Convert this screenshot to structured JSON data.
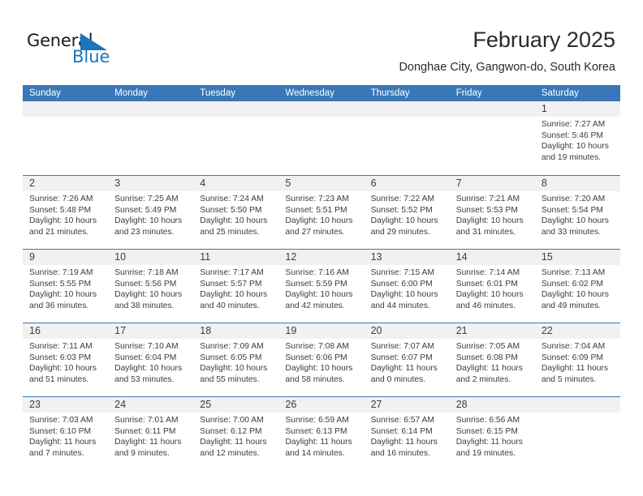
{
  "brand": {
    "name_part1": "General",
    "name_part2": "Blue",
    "triangle_color": "#1b75bc"
  },
  "header": {
    "month_title": "February 2025",
    "location": "Donghae City, Gangwon-do, South Korea"
  },
  "theme": {
    "header_blue": "#3878b8",
    "day_band_gray": "#f1f1f1",
    "text_dark": "#3c3c3c",
    "brand_blue": "#1b75bc"
  },
  "weekdays": [
    "Sunday",
    "Monday",
    "Tuesday",
    "Wednesday",
    "Thursday",
    "Friday",
    "Saturday"
  ],
  "weeks": [
    [
      {
        "day": "",
        "sunrise": "",
        "sunset": "",
        "daylight": "",
        "empty": true
      },
      {
        "day": "",
        "sunrise": "",
        "sunset": "",
        "daylight": "",
        "empty": true
      },
      {
        "day": "",
        "sunrise": "",
        "sunset": "",
        "daylight": "",
        "empty": true
      },
      {
        "day": "",
        "sunrise": "",
        "sunset": "",
        "daylight": "",
        "empty": true
      },
      {
        "day": "",
        "sunrise": "",
        "sunset": "",
        "daylight": "",
        "empty": true
      },
      {
        "day": "",
        "sunrise": "",
        "sunset": "",
        "daylight": "",
        "empty": true
      },
      {
        "day": "1",
        "sunrise": "Sunrise: 7:27 AM",
        "sunset": "Sunset: 5:46 PM",
        "daylight": "Daylight: 10 hours and 19 minutes."
      }
    ],
    [
      {
        "day": "2",
        "sunrise": "Sunrise: 7:26 AM",
        "sunset": "Sunset: 5:48 PM",
        "daylight": "Daylight: 10 hours and 21 minutes."
      },
      {
        "day": "3",
        "sunrise": "Sunrise: 7:25 AM",
        "sunset": "Sunset: 5:49 PM",
        "daylight": "Daylight: 10 hours and 23 minutes."
      },
      {
        "day": "4",
        "sunrise": "Sunrise: 7:24 AM",
        "sunset": "Sunset: 5:50 PM",
        "daylight": "Daylight: 10 hours and 25 minutes."
      },
      {
        "day": "5",
        "sunrise": "Sunrise: 7:23 AM",
        "sunset": "Sunset: 5:51 PM",
        "daylight": "Daylight: 10 hours and 27 minutes."
      },
      {
        "day": "6",
        "sunrise": "Sunrise: 7:22 AM",
        "sunset": "Sunset: 5:52 PM",
        "daylight": "Daylight: 10 hours and 29 minutes."
      },
      {
        "day": "7",
        "sunrise": "Sunrise: 7:21 AM",
        "sunset": "Sunset: 5:53 PM",
        "daylight": "Daylight: 10 hours and 31 minutes."
      },
      {
        "day": "8",
        "sunrise": "Sunrise: 7:20 AM",
        "sunset": "Sunset: 5:54 PM",
        "daylight": "Daylight: 10 hours and 33 minutes."
      }
    ],
    [
      {
        "day": "9",
        "sunrise": "Sunrise: 7:19 AM",
        "sunset": "Sunset: 5:55 PM",
        "daylight": "Daylight: 10 hours and 36 minutes."
      },
      {
        "day": "10",
        "sunrise": "Sunrise: 7:18 AM",
        "sunset": "Sunset: 5:56 PM",
        "daylight": "Daylight: 10 hours and 38 minutes."
      },
      {
        "day": "11",
        "sunrise": "Sunrise: 7:17 AM",
        "sunset": "Sunset: 5:57 PM",
        "daylight": "Daylight: 10 hours and 40 minutes."
      },
      {
        "day": "12",
        "sunrise": "Sunrise: 7:16 AM",
        "sunset": "Sunset: 5:59 PM",
        "daylight": "Daylight: 10 hours and 42 minutes."
      },
      {
        "day": "13",
        "sunrise": "Sunrise: 7:15 AM",
        "sunset": "Sunset: 6:00 PM",
        "daylight": "Daylight: 10 hours and 44 minutes."
      },
      {
        "day": "14",
        "sunrise": "Sunrise: 7:14 AM",
        "sunset": "Sunset: 6:01 PM",
        "daylight": "Daylight: 10 hours and 46 minutes."
      },
      {
        "day": "15",
        "sunrise": "Sunrise: 7:13 AM",
        "sunset": "Sunset: 6:02 PM",
        "daylight": "Daylight: 10 hours and 49 minutes."
      }
    ],
    [
      {
        "day": "16",
        "sunrise": "Sunrise: 7:11 AM",
        "sunset": "Sunset: 6:03 PM",
        "daylight": "Daylight: 10 hours and 51 minutes."
      },
      {
        "day": "17",
        "sunrise": "Sunrise: 7:10 AM",
        "sunset": "Sunset: 6:04 PM",
        "daylight": "Daylight: 10 hours and 53 minutes."
      },
      {
        "day": "18",
        "sunrise": "Sunrise: 7:09 AM",
        "sunset": "Sunset: 6:05 PM",
        "daylight": "Daylight: 10 hours and 55 minutes."
      },
      {
        "day": "19",
        "sunrise": "Sunrise: 7:08 AM",
        "sunset": "Sunset: 6:06 PM",
        "daylight": "Daylight: 10 hours and 58 minutes."
      },
      {
        "day": "20",
        "sunrise": "Sunrise: 7:07 AM",
        "sunset": "Sunset: 6:07 PM",
        "daylight": "Daylight: 11 hours and 0 minutes."
      },
      {
        "day": "21",
        "sunrise": "Sunrise: 7:05 AM",
        "sunset": "Sunset: 6:08 PM",
        "daylight": "Daylight: 11 hours and 2 minutes."
      },
      {
        "day": "22",
        "sunrise": "Sunrise: 7:04 AM",
        "sunset": "Sunset: 6:09 PM",
        "daylight": "Daylight: 11 hours and 5 minutes."
      }
    ],
    [
      {
        "day": "23",
        "sunrise": "Sunrise: 7:03 AM",
        "sunset": "Sunset: 6:10 PM",
        "daylight": "Daylight: 11 hours and 7 minutes."
      },
      {
        "day": "24",
        "sunrise": "Sunrise: 7:01 AM",
        "sunset": "Sunset: 6:11 PM",
        "daylight": "Daylight: 11 hours and 9 minutes."
      },
      {
        "day": "25",
        "sunrise": "Sunrise: 7:00 AM",
        "sunset": "Sunset: 6:12 PM",
        "daylight": "Daylight: 11 hours and 12 minutes."
      },
      {
        "day": "26",
        "sunrise": "Sunrise: 6:59 AM",
        "sunset": "Sunset: 6:13 PM",
        "daylight": "Daylight: 11 hours and 14 minutes."
      },
      {
        "day": "27",
        "sunrise": "Sunrise: 6:57 AM",
        "sunset": "Sunset: 6:14 PM",
        "daylight": "Daylight: 11 hours and 16 minutes."
      },
      {
        "day": "28",
        "sunrise": "Sunrise: 6:56 AM",
        "sunset": "Sunset: 6:15 PM",
        "daylight": "Daylight: 11 hours and 19 minutes."
      },
      {
        "day": "",
        "sunrise": "",
        "sunset": "",
        "daylight": "",
        "empty": true
      }
    ]
  ]
}
